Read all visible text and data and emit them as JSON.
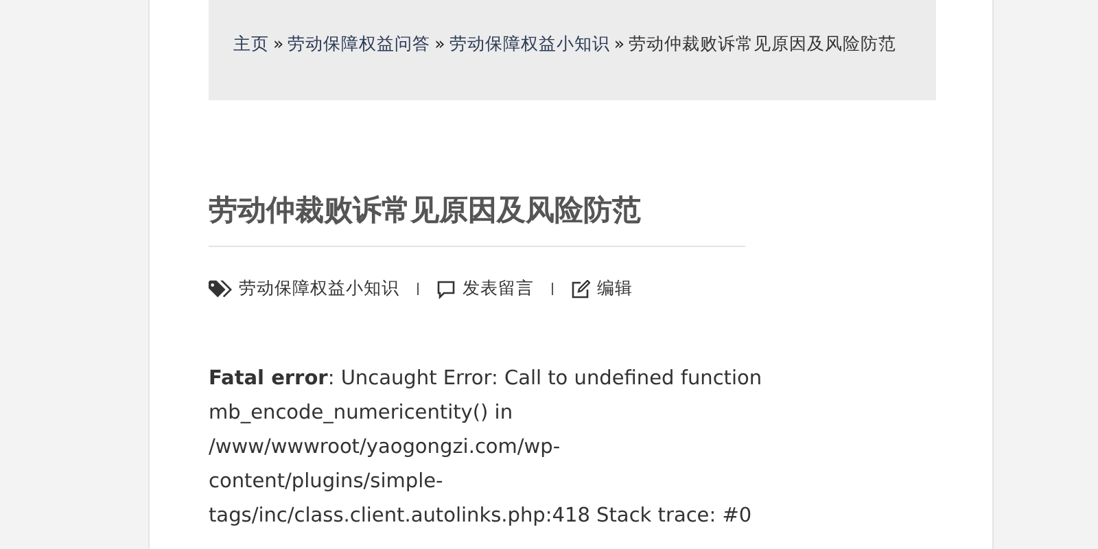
{
  "breadcrumb": {
    "links": [
      "主页",
      "劳动保障权益问答",
      "劳动保障权益小知识"
    ],
    "separator": "»",
    "current": "劳动仲裁败诉常见原因及风险防范"
  },
  "title": "劳动仲裁败诉常见原因及风险防范",
  "meta": [
    {
      "kind": "category",
      "text": "劳动保障权益小知识"
    },
    {
      "kind": "comment",
      "text": "发表留言"
    },
    {
      "kind": "edit",
      "text": "编辑"
    }
  ],
  "error": {
    "label": "Fatal error",
    "lines": [
      ": Uncaught Error: Call to undefined function",
      "mb_encode_numericentity() in",
      "/www/wwwroot/yaogongzi.com/wp-",
      "content/plugins/simple-",
      "tags/inc/class.client.autolinks.php:418 Stack trace: #0"
    ]
  }
}
